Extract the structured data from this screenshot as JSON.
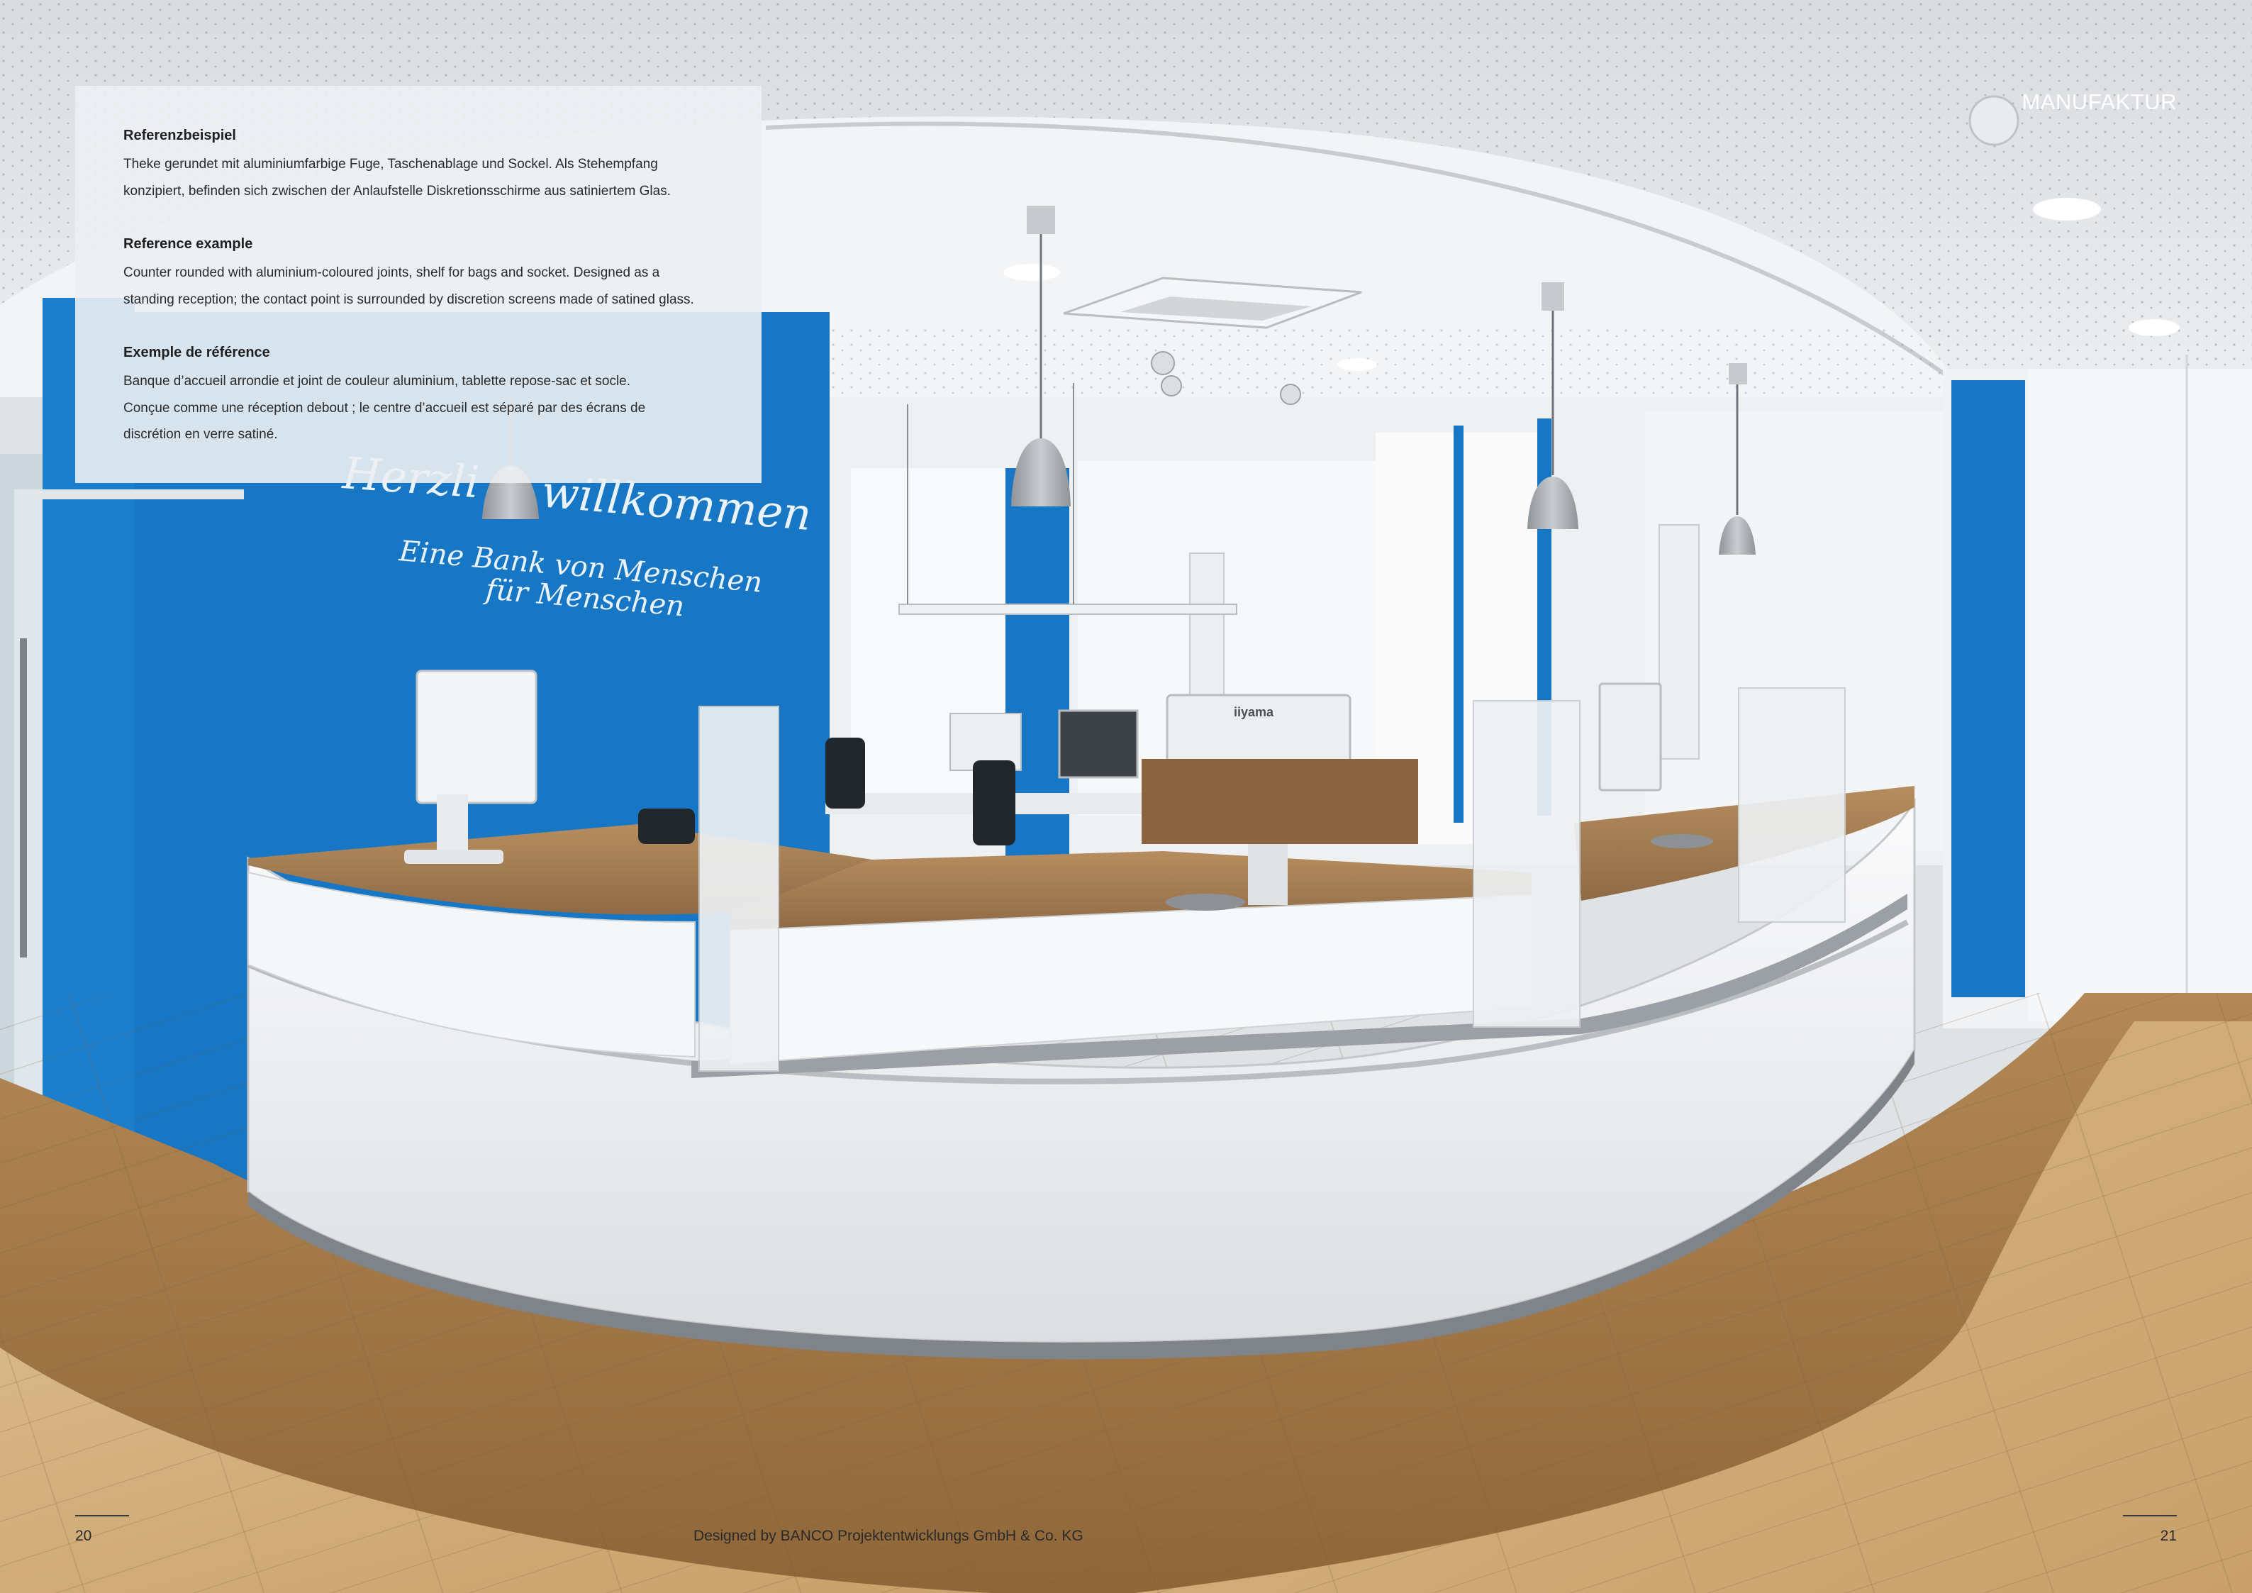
{
  "section_label": "MANUFAKTUR",
  "description": {
    "blocks": [
      {
        "heading": "Referenzbeispiel",
        "lines": [
          "Theke gerundet mit aluminiumfarbige Fuge, Taschenablage und Sockel. Als Stehempfang",
          "konzipiert, befinden sich zwischen der Anlaufstelle Diskretionsschirme aus satiniertem Glas."
        ]
      },
      {
        "heading": "Reference example",
        "lines": [
          "Counter rounded with aluminium-coloured joints, shelf for bags and socket. Designed as a",
          "standing reception; the contact point is surrounded by discretion screens made of satined glass."
        ]
      },
      {
        "heading": "Exemple de référence",
        "lines": [
          "Banque d’accueil arrondie et joint de couleur aluminium, tablette repose-sac et socle.",
          "Conçue comme une réception debout ; le centre d’accueil est séparé par des écrans de",
          "discrétion en verre satiné."
        ]
      }
    ]
  },
  "photo": {
    "wall_lettering": {
      "line1_a": "Herzli",
      "line1_b": "willkommen",
      "line2": "Eine Bank von Menschen",
      "line3": "für Menschen"
    },
    "monitor_brand": "iiyama"
  },
  "footer": {
    "page_left": "20",
    "page_right": "21",
    "credit": "Designed by BANCO Projektentwicklungs GmbH & Co. KG"
  },
  "colors": {
    "wall_blue": "#1777c4",
    "wood": "#a97a46",
    "counter_white": "#f4f5f6",
    "ceiling": "#e4e6e8"
  }
}
